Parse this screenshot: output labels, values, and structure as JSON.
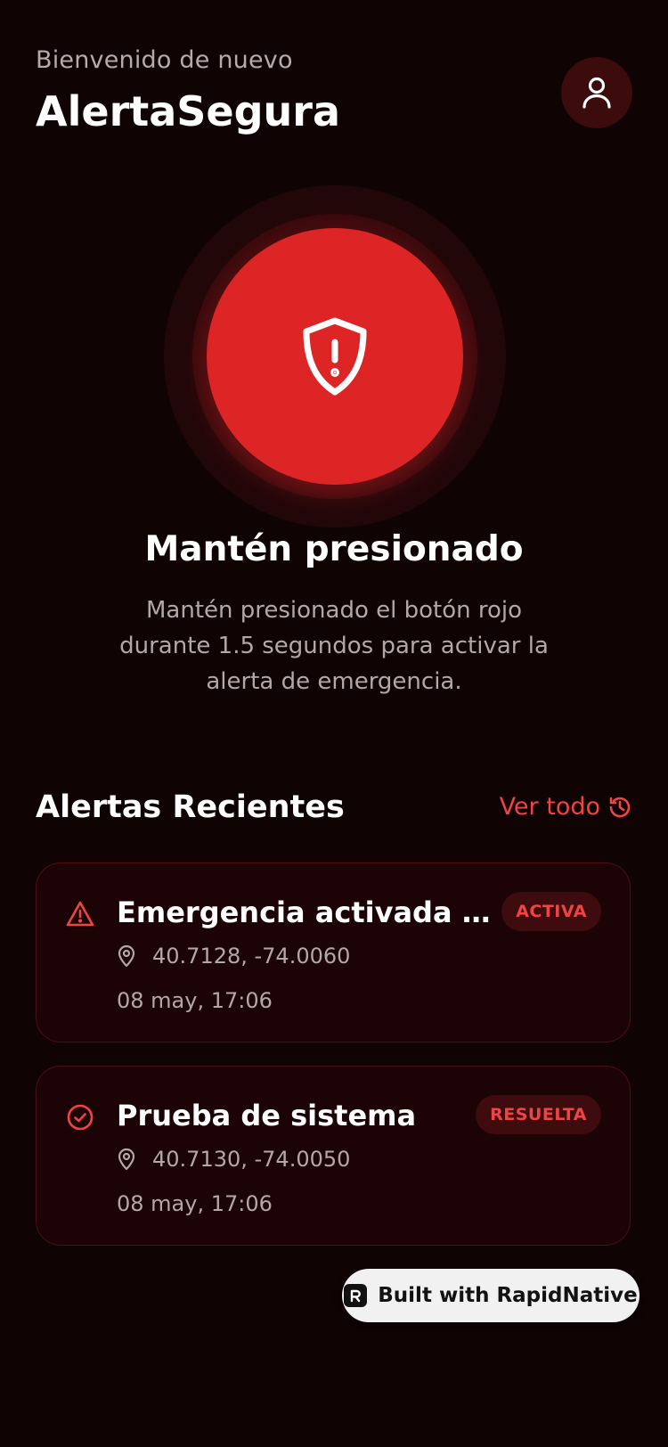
{
  "header": {
    "greeting": "Bienvenido de nuevo",
    "title": "AlertaSegura",
    "profile_icon": "user-icon"
  },
  "emergency": {
    "button_icon": "shield-alert-icon",
    "title": "Mantén presionado",
    "description": "Mantén presionado el botón rojo durante 1.5 segundos para activar la alerta de emergencia."
  },
  "recent": {
    "title": "Alertas Recientes",
    "see_all_label": "Ver todo",
    "see_all_icon": "history-icon",
    "alerts": [
      {
        "icon": "warning-triangle-icon",
        "title": "Emergencia activada por el usuario",
        "status": "ACTIVA",
        "coords": "40.7128, -74.0060",
        "time": "08 may, 17:06"
      },
      {
        "icon": "check-circle-icon",
        "title": "Prueba de sistema",
        "status": "RESUELTA",
        "coords": "40.7130, -74.0050",
        "time": "08 may, 17:06"
      }
    ]
  },
  "footer": {
    "built_with": "Built with RapidNative"
  },
  "colors": {
    "background": "#0f0304",
    "accent": "#ef4444",
    "button": "#dd2526",
    "card": "#1c0406"
  }
}
